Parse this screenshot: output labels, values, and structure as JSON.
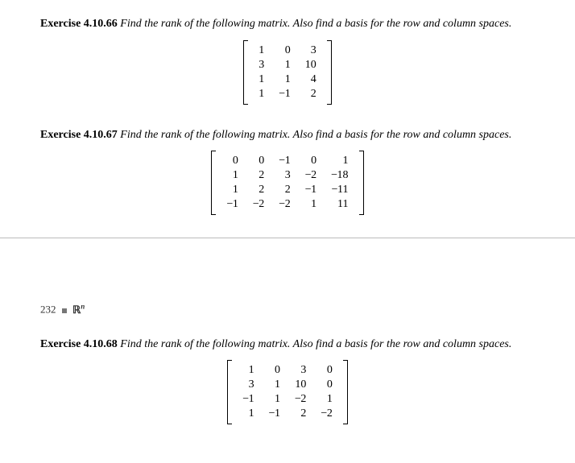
{
  "exercises": [
    {
      "label": "Exercise 4.10.66",
      "prompt": "Find the rank of the following matrix. Also find a basis for the row and column spaces."
    },
    {
      "label": "Exercise 4.10.67",
      "prompt": "Find the rank of the following matrix. Also find a basis for the row and column spaces."
    },
    {
      "label": "Exercise 4.10.68",
      "prompt": "Find the rank of the following matrix. Also find a basis for the row and column spaces."
    }
  ],
  "pageHeader": {
    "pageNum": "232",
    "sectionLabel": "ℝ",
    "sectionSup": "n"
  },
  "chart_data": [
    {
      "type": "table",
      "title": "Matrix for Exercise 4.10.66",
      "rows": 4,
      "cols": 3,
      "values": [
        [
          1,
          0,
          3
        ],
        [
          3,
          1,
          10
        ],
        [
          1,
          1,
          4
        ],
        [
          1,
          -1,
          2
        ]
      ]
    },
    {
      "type": "table",
      "title": "Matrix for Exercise 4.10.67",
      "rows": 4,
      "cols": 5,
      "values": [
        [
          0,
          0,
          -1,
          0,
          1
        ],
        [
          1,
          2,
          3,
          -2,
          -18
        ],
        [
          1,
          2,
          2,
          -1,
          -11
        ],
        [
          -1,
          -2,
          -2,
          1,
          11
        ]
      ]
    },
    {
      "type": "table",
      "title": "Matrix for Exercise 4.10.68",
      "rows": 4,
      "cols": 4,
      "values": [
        [
          1,
          0,
          3,
          0
        ],
        [
          3,
          1,
          10,
          0
        ],
        [
          -1,
          1,
          -2,
          1
        ],
        [
          1,
          -1,
          2,
          -2
        ]
      ]
    }
  ]
}
